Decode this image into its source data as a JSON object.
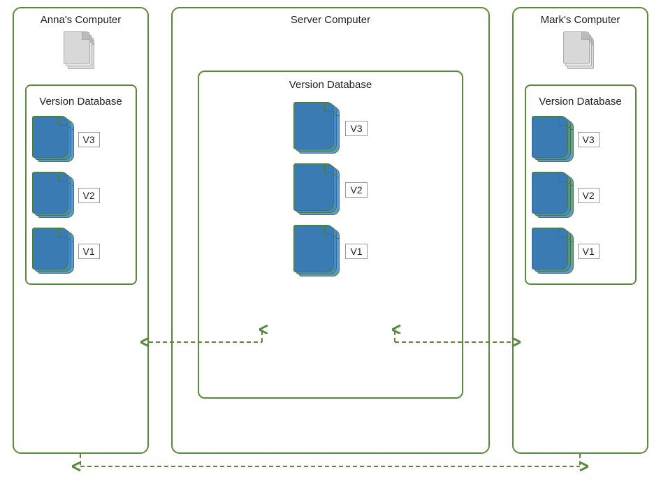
{
  "anna": {
    "title": "Anna's Computer",
    "db_label": "Version Database",
    "versions": [
      "V3",
      "V2",
      "V1"
    ]
  },
  "server": {
    "title": "Server Computer",
    "db_label": "Version Database",
    "versions": [
      "V3",
      "V2",
      "V1"
    ]
  },
  "mark": {
    "title": "Mark's Computer",
    "db_label": "Version Database",
    "versions": [
      "V3",
      "V2",
      "V1"
    ]
  }
}
